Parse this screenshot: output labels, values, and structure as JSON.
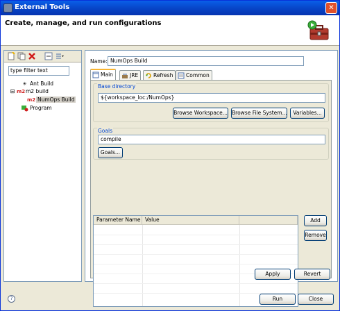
{
  "window": {
    "title": "External Tools",
    "close_glyph": "✕"
  },
  "header": {
    "title": "Create, manage, and run configurations",
    "icon": "toolbox-run-icon"
  },
  "left": {
    "toolbar_icons": [
      "new-config-icon",
      "duplicate-config-icon",
      "delete-config-icon",
      "collapse-all-icon",
      "filter-menu-icon"
    ],
    "filter_placeholder": "type filter text",
    "tree": [
      {
        "label": "Ant Build",
        "icon": "ant-icon",
        "prefix": ""
      },
      {
        "label": "m2 build",
        "icon": "m2-icon",
        "prefix": "m2",
        "expander": "⊟"
      },
      {
        "label": "NumOps Build",
        "icon": "m2-icon",
        "prefix": "m2",
        "selected": true
      },
      {
        "label": "Program",
        "icon": "program-icon",
        "prefix": ""
      }
    ]
  },
  "config": {
    "name_label": "Name:",
    "name_value": "NumOps Build",
    "tabs": [
      {
        "label": "Main",
        "icon": "main-tab-icon",
        "active": true
      },
      {
        "label": "JRE",
        "icon": "jre-tab-icon"
      },
      {
        "label": "Refresh",
        "icon": "refresh-tab-icon"
      },
      {
        "label": "Common",
        "icon": "common-tab-icon"
      }
    ],
    "base_dir": {
      "label": "Base directory",
      "value": "${workspace_loc:/NumOps}",
      "browse_workspace": "Browse Workspace...",
      "browse_fs": "Browse File System...",
      "variables": "Variables..."
    },
    "goals": {
      "label": "Goals",
      "value": "compile",
      "button": "Goals..."
    },
    "params": {
      "columns": [
        "Parameter Name",
        "Value"
      ],
      "rows": [],
      "add": "Add",
      "remove": "Remove"
    },
    "apply": "Apply",
    "revert": "Revert"
  },
  "footer": {
    "run": "Run",
    "close": "Close",
    "help_glyph": "?"
  },
  "colors": {
    "title_bar": "#0A5FE8",
    "group_label": "#0046D5",
    "m2_red": "#D02020"
  }
}
